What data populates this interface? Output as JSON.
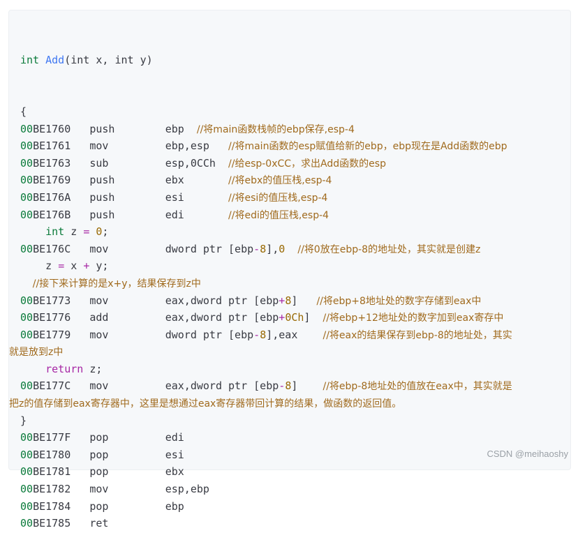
{
  "code": {
    "signature": {
      "type": "int",
      "name": "Add",
      "params": "(int x, int y)"
    },
    "lines": [
      {
        "kind": "plain",
        "text": "{"
      },
      {
        "kind": "asm",
        "addr_hi": "00",
        "addr_lo": "BE1760",
        "op": "push",
        "args": "ebp",
        "pad": "  ",
        "comment": "//将main函数栈帧的ebp保存,esp-4"
      },
      {
        "kind": "asm",
        "addr_hi": "00",
        "addr_lo": "BE1761",
        "op": "mov",
        "args": "ebp,esp",
        "pad": "   ",
        "comment": "//将main函数的esp赋值给新的ebp，ebp现在是Add函数的ebp"
      },
      {
        "kind": "asm",
        "addr_hi": "00",
        "addr_lo": "BE1763",
        "op": "sub",
        "args": "esp,0CCh",
        "pad": "  ",
        "comment": "//给esp-0xCC，求出Add函数的esp"
      },
      {
        "kind": "asm",
        "addr_hi": "00",
        "addr_lo": "BE1769",
        "op": "push",
        "args": "ebx",
        "pad": "       ",
        "comment": "//将ebx的值压栈,esp-4"
      },
      {
        "kind": "asm",
        "addr_hi": "00",
        "addr_lo": "BE176A",
        "op": "push",
        "args": "esi",
        "pad": "       ",
        "comment": "//将esi的值压栈,esp-4"
      },
      {
        "kind": "asm",
        "addr_hi": "00",
        "addr_lo": "BE176B",
        "op": "push",
        "args": "edi",
        "pad": "       ",
        "comment": "//将edi的值压栈,esp-4"
      },
      {
        "kind": "src",
        "text": "    int z = 0;"
      },
      {
        "kind": "asm",
        "addr_hi": "00",
        "addr_lo": "BE176C",
        "op": "mov",
        "args": "dword ptr [ebp-8],0",
        "pad": "  ",
        "comment": "//将0放在ebp-8的地址处，其实就是创建z"
      },
      {
        "kind": "src",
        "text": "    z = x + y;"
      },
      {
        "kind": "srccmt",
        "text": "    //接下来计算的是x+y，结果保存到z中"
      },
      {
        "kind": "asm",
        "addr_hi": "00",
        "addr_lo": "BE1773",
        "op": "mov",
        "args": "eax,dword ptr [ebp+8]",
        "pad": "   ",
        "comment": "//将ebp+8地址处的数字存储到eax中"
      },
      {
        "kind": "asm",
        "addr_hi": "00",
        "addr_lo": "BE1776",
        "op": "add",
        "args": "eax,dword ptr [ebp+0Ch]",
        "pad": "  ",
        "comment": "//将ebp+12地址处的数字加到eax寄存中"
      },
      {
        "kind": "asm",
        "addr_hi": "00",
        "addr_lo": "BE1779",
        "op": "mov",
        "args": "dword ptr [ebp-8],eax",
        "pad": "    ",
        "comment": "//将eax的结果保存到ebp-8的地址处，其实",
        "cont": "就是放到z中"
      },
      {
        "kind": "src",
        "text": "    return z;"
      },
      {
        "kind": "asm",
        "addr_hi": "00",
        "addr_lo": "BE177C",
        "op": "mov",
        "args": "eax,dword ptr [ebp-8]",
        "pad": "    ",
        "comment": "//将ebp-8地址处的值放在eax中，其实就是",
        "cont": "把z的值存储到eax寄存器中，这里是想通过eax寄存器带回计算的结果，做函数的返回值。"
      },
      {
        "kind": "plain",
        "text": "}"
      },
      {
        "kind": "asm",
        "addr_hi": "00",
        "addr_lo": "BE177F",
        "op": "pop",
        "args": "edi",
        "pad": "",
        "comment": ""
      },
      {
        "kind": "asm",
        "addr_hi": "00",
        "addr_lo": "BE1780",
        "op": "pop",
        "args": "esi",
        "pad": "",
        "comment": ""
      },
      {
        "kind": "asm",
        "addr_hi": "00",
        "addr_lo": "BE1781",
        "op": "pop",
        "args": "ebx",
        "pad": "",
        "comment": ""
      },
      {
        "kind": "asm",
        "addr_hi": "00",
        "addr_lo": "BE1782",
        "op": "mov",
        "args": "esp,ebp",
        "pad": "",
        "comment": ""
      },
      {
        "kind": "asm",
        "addr_hi": "00",
        "addr_lo": "BE1784",
        "op": "pop",
        "args": "ebp",
        "pad": "",
        "comment": ""
      },
      {
        "kind": "asm",
        "addr_hi": "00",
        "addr_lo": "BE1785",
        "op": "ret",
        "args": "",
        "pad": "",
        "comment": ""
      }
    ]
  },
  "watermark": "CSDN @meihaoshy"
}
